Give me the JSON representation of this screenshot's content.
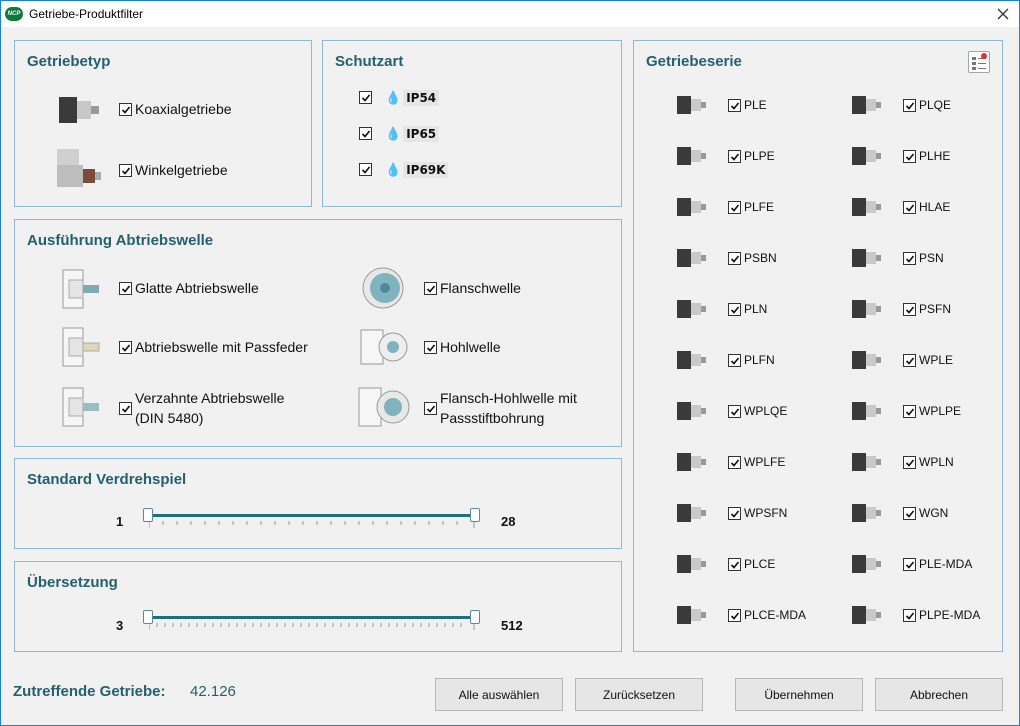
{
  "window": {
    "title": "Getriebe-Produktfilter",
    "app_icon_text": "NCP"
  },
  "getriebetyp": {
    "title": "Getriebetyp",
    "items": [
      {
        "label": "Koaxialgetriebe",
        "checked": true
      },
      {
        "label": "Winkelgetriebe",
        "checked": true
      }
    ]
  },
  "schutzart": {
    "title": "Schutzart",
    "items": [
      {
        "label": "IP54",
        "checked": true
      },
      {
        "label": "IP65",
        "checked": true
      },
      {
        "label": "IP69K",
        "checked": true
      }
    ]
  },
  "abtriebswelle": {
    "title": "Ausführung Abtriebswelle",
    "items": [
      {
        "label": "Glatte Abtriebswelle",
        "checked": true
      },
      {
        "label": "Flanschwelle",
        "checked": true
      },
      {
        "label": "Abtriebswelle mit Passfeder",
        "checked": true
      },
      {
        "label": "Hohlwelle",
        "checked": true
      },
      {
        "label_line1": "Verzahnte Abtriebswelle",
        "label_line2": "(DIN 5480)",
        "checked": true
      },
      {
        "label_line1": "Flansch-Hohlwelle mit",
        "label_line2": "Passstiftbohrung",
        "checked": true
      }
    ]
  },
  "verdrehspiel": {
    "title": "Standard Verdrehspiel",
    "min": "1",
    "max": "28"
  },
  "uebersetzung": {
    "title": "Übersetzung",
    "min": "3",
    "max": "512"
  },
  "getriebeserie": {
    "title": "Getriebeserie",
    "items": [
      {
        "label": "PLE",
        "checked": true
      },
      {
        "label": "PLQE",
        "checked": true
      },
      {
        "label": "PLPE",
        "checked": true
      },
      {
        "label": "PLHE",
        "checked": true
      },
      {
        "label": "PLFE",
        "checked": true
      },
      {
        "label": "HLAE",
        "checked": true
      },
      {
        "label": "PSBN",
        "checked": true
      },
      {
        "label": "PSN",
        "checked": true
      },
      {
        "label": "PLN",
        "checked": true
      },
      {
        "label": "PSFN",
        "checked": true
      },
      {
        "label": "PLFN",
        "checked": true
      },
      {
        "label": "WPLE",
        "checked": true
      },
      {
        "label": "WPLQE",
        "checked": true
      },
      {
        "label": "WPLPE",
        "checked": true
      },
      {
        "label": "WPLFE",
        "checked": true
      },
      {
        "label": "WPLN",
        "checked": true
      },
      {
        "label": "WPSFN",
        "checked": true
      },
      {
        "label": "WGN",
        "checked": true
      },
      {
        "label": "PLCE",
        "checked": true
      },
      {
        "label": "PLE-MDA",
        "checked": true
      },
      {
        "label": "PLCE-MDA",
        "checked": true
      },
      {
        "label": "PLPE-MDA",
        "checked": true
      }
    ]
  },
  "footer": {
    "result_label": "Zutreffende Getriebe:",
    "result_count": "42.126",
    "select_all": "Alle auswählen",
    "reset": "Zurücksetzen",
    "apply": "Übernehmen",
    "cancel": "Abbrechen"
  },
  "colors": {
    "accent": "#24606e",
    "border": "#8fb9d2",
    "window_border": "#1e7fd8"
  }
}
